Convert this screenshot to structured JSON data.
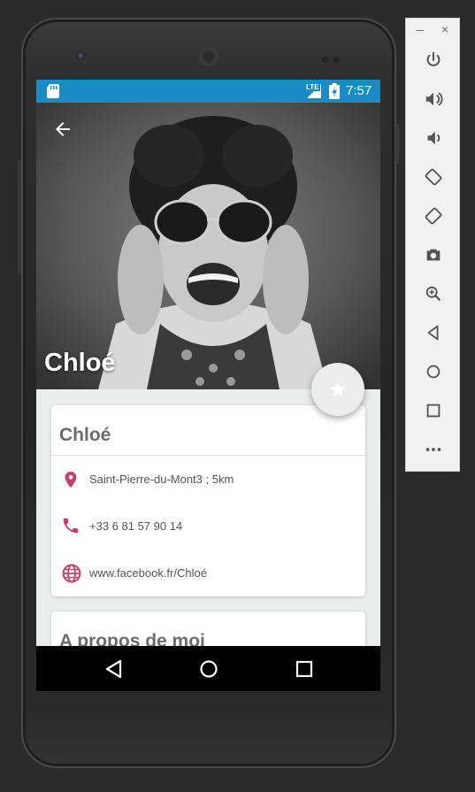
{
  "status_bar": {
    "network": "LTE",
    "time": "7:57"
  },
  "profile": {
    "hero_name": "Chloé",
    "card_title": "Chloé",
    "location": "Saint-Pierre-du-Mont3 ; 5km",
    "phone": "+33 6 81 57 90 14",
    "website": "www.facebook.fr/Chloé"
  },
  "about": {
    "title": "A propos de moi"
  },
  "colors": {
    "status_bar": "#1c8ac4",
    "accent": "#c2416b",
    "screen_bg": "#e9eeed"
  },
  "toolbar": {
    "minimize": "–",
    "close": "×",
    "icons": [
      "power-icon",
      "volume-up-icon",
      "volume-down-icon",
      "rotate-left-icon",
      "rotate-right-icon",
      "camera-icon",
      "zoom-icon",
      "back-icon",
      "home-icon",
      "overview-icon",
      "more-icon"
    ]
  }
}
